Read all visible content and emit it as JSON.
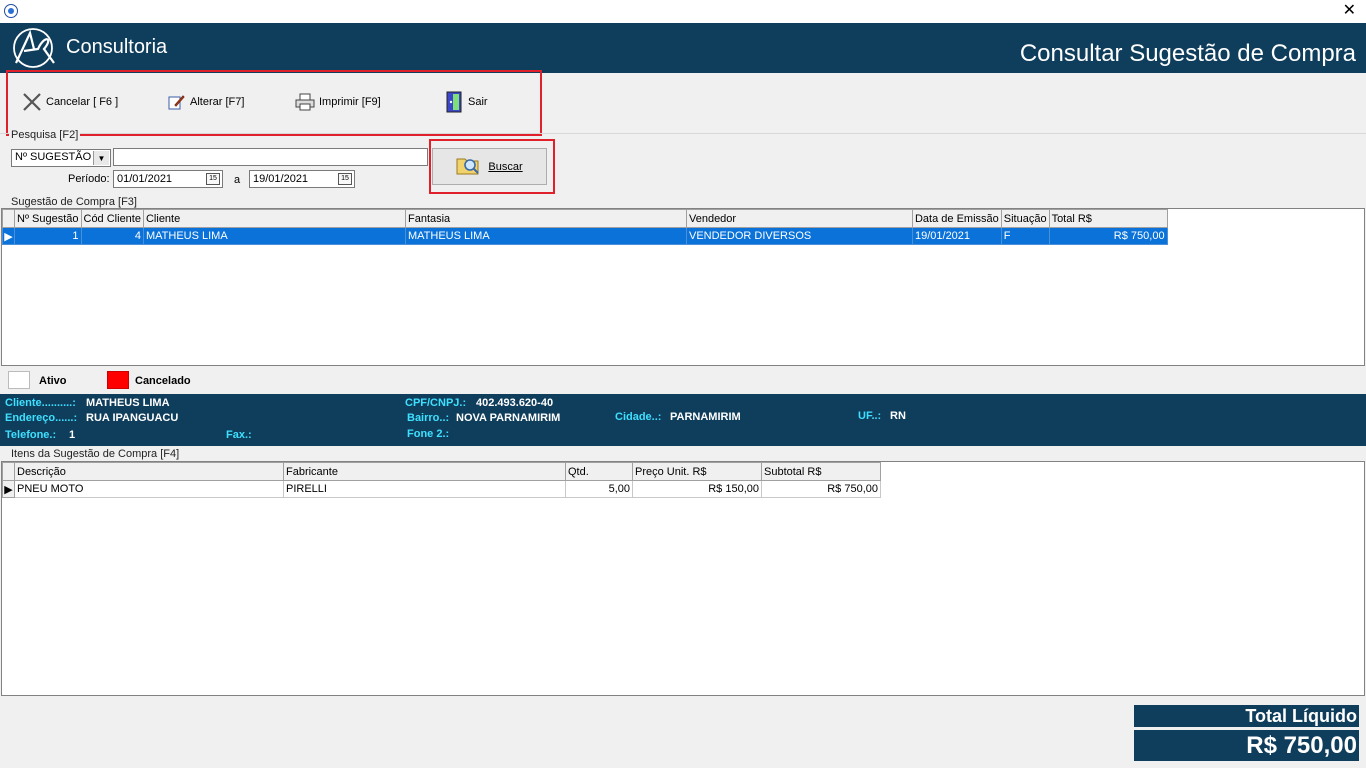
{
  "window": {
    "close_glyph": "✕"
  },
  "header": {
    "brand": "Consultoria",
    "title": "Consultar Sugestão de Compra"
  },
  "toolbar": {
    "cancelar": "Cancelar [ F6 ]",
    "alterar": "Alterar [F7]",
    "imprimir": "Imprimir  [F9]",
    "sair": "Sair"
  },
  "search": {
    "group_label": "Pesquisa [F2]",
    "field_select": "Nº SUGESTÃO",
    "query": "",
    "periodo_label": "Período:",
    "date_from": "01/01/2021",
    "date_sep": "a",
    "date_to": "19/01/2021",
    "calendar_glyph": "15",
    "buscar": "Buscar"
  },
  "sugestoes": {
    "group_label": "Sugestão de Compra [F3]",
    "columns": [
      "Nº Sugestão",
      "Cód Cliente",
      "Cliente",
      "Fantasia",
      "Vendedor",
      "Data de Emissão",
      "Situação",
      "Total R$"
    ],
    "rows": [
      [
        "1",
        "4",
        "MATHEUS LIMA",
        "MATHEUS LIMA",
        "VENDEDOR DIVERSOS",
        "19/01/2021",
        "F",
        "R$ 750,00"
      ]
    ]
  },
  "legend": {
    "ativo": "Ativo",
    "cancelado": "Cancelado",
    "ativo_color": "#ffffff",
    "cancelado_color": "#ff0000"
  },
  "cliente_info": {
    "cliente_label": "Cliente..........:",
    "cliente": "MATHEUS LIMA",
    "cpf_label": "CPF/CNPJ.:",
    "cpf": "402.493.620-40",
    "endereco_label": "Endereço......:",
    "endereco": "RUA IPANGUACU",
    "bairro_label": "Bairro..:",
    "bairro": "NOVA PARNAMIRIM",
    "cidade_label": "Cidade..:",
    "cidade": "PARNAMIRIM",
    "uf_label": "UF..:",
    "uf": "RN",
    "telefone_label": "Telefone.:",
    "telefone": "1",
    "fax_label": "Fax.:",
    "fax": "",
    "fone2_label": "Fone 2.:",
    "fone2": ""
  },
  "itens": {
    "group_label": "Itens da Sugestão de Compra [F4]",
    "columns": [
      "Descrição",
      "Fabricante",
      "Qtd.",
      "Preço Unit. R$",
      "Subtotal R$"
    ],
    "rows": [
      [
        "PNEU MOTO",
        "PIRELLI",
        "5,00",
        "R$ 150,00",
        "R$ 750,00"
      ]
    ]
  },
  "totals": {
    "label": "Total Líquido",
    "value": "R$ 750,00"
  },
  "colors": {
    "header_bg": "#0f3d5c",
    "info_key": "#3ee0ff",
    "selection": "#0a72d8",
    "highlight_border": "#e0202a"
  }
}
